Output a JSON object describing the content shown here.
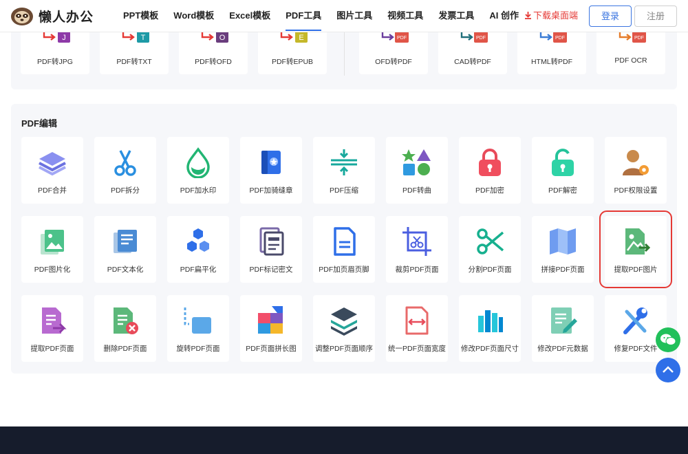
{
  "header": {
    "logo_text": "懒人办公",
    "nav": [
      "PPT模板",
      "Word模板",
      "Excel模板",
      "PDF工具",
      "图片工具",
      "视频工具",
      "发票工具",
      "AI 创作"
    ],
    "active_nav": "PDF工具",
    "download_label": "下载桌面端",
    "login_label": "登录",
    "register_label": "注册"
  },
  "convert_section": {
    "items": [
      {
        "label": "PDF转JPG",
        "badge": "J"
      },
      {
        "label": "PDF转TXT",
        "badge": "T"
      },
      {
        "label": "PDF转OFD",
        "badge": "O"
      },
      {
        "label": "PDF转EPUB",
        "badge": "E"
      },
      {
        "label": "OFD转PDF",
        "badge": "PDF"
      },
      {
        "label": "CAD转PDF",
        "badge": "PDF"
      },
      {
        "label": "HTML转PDF",
        "badge": "PDF"
      },
      {
        "label": "PDF OCR",
        "badge": "PDF"
      }
    ]
  },
  "edit_section": {
    "title": "PDF编辑",
    "rows": [
      [
        {
          "label": "PDF合并",
          "icon": "layers-icon"
        },
        {
          "label": "PDF拆分",
          "icon": "scissors-icon"
        },
        {
          "label": "PDF加水印",
          "icon": "water-drop-icon"
        },
        {
          "label": "PDF加骑缝章",
          "icon": "seal-book-icon"
        },
        {
          "label": "PDF压缩",
          "icon": "compress-icon"
        },
        {
          "label": "PDF转曲",
          "icon": "shapes-icon"
        },
        {
          "label": "PDF加密",
          "icon": "lock-icon"
        },
        {
          "label": "PDF解密",
          "icon": "unlock-icon"
        },
        {
          "label": "PDF权限设置",
          "icon": "user-gear-icon"
        }
      ],
      [
        {
          "label": "PDF图片化",
          "icon": "image-stack-icon"
        },
        {
          "label": "PDF文本化",
          "icon": "text-doc-icon"
        },
        {
          "label": "PDF扁平化",
          "icon": "hexagons-icon"
        },
        {
          "label": "PDF标记密文",
          "icon": "redact-doc-icon"
        },
        {
          "label": "PDF加页眉页脚",
          "icon": "header-footer-icon"
        },
        {
          "label": "裁剪PDF页面",
          "icon": "crop-icon"
        },
        {
          "label": "分割PDF页面",
          "icon": "split-scissors-icon"
        },
        {
          "label": "拼接PDF页面",
          "icon": "map-fold-icon"
        },
        {
          "label": "提取PDF图片",
          "icon": "extract-image-icon"
        }
      ],
      [
        {
          "label": "提取PDF页面",
          "icon": "extract-page-icon"
        },
        {
          "label": "删除PDF页面",
          "icon": "delete-page-icon"
        },
        {
          "label": "旋转PDF页面",
          "icon": "rotate-page-icon"
        },
        {
          "label": "PDF页面拼长图",
          "icon": "puzzle-icon"
        },
        {
          "label": "调整PDF页面顺序",
          "icon": "reorder-layers-icon"
        },
        {
          "label": "统一PDF页面宽度",
          "icon": "width-doc-icon"
        },
        {
          "label": "修改PDF页面尺寸",
          "icon": "resize-bars-icon"
        },
        {
          "label": "修改PDF元数据",
          "icon": "edit-doc-icon"
        },
        {
          "label": "修复PDF文件",
          "icon": "wrench-icon"
        }
      ]
    ]
  },
  "colors": {
    "accent": "#2f6fe8",
    "highlight_border": "#e53935",
    "download": "#e53935",
    "footer": "#161c2c"
  }
}
